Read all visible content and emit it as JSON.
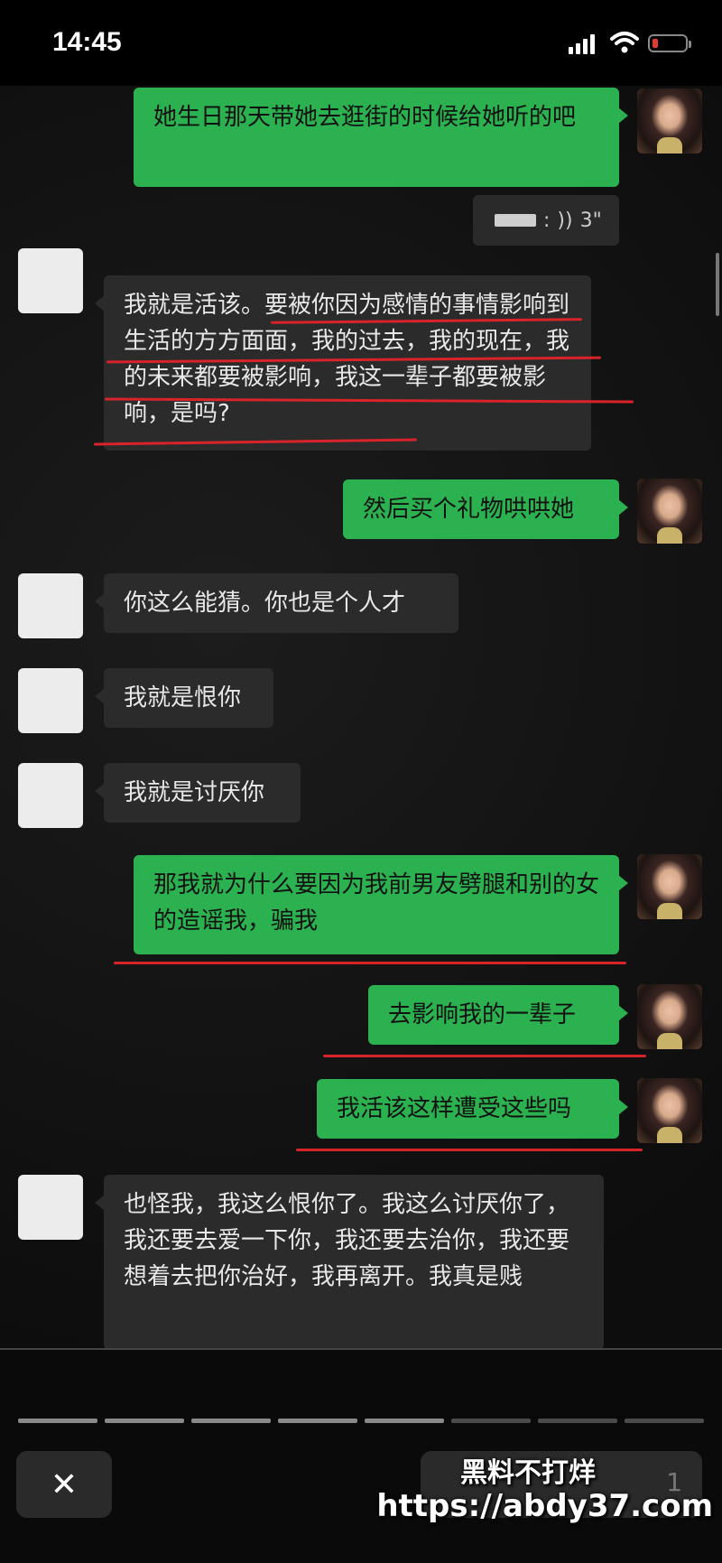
{
  "status": {
    "time": "14:45"
  },
  "voice": {
    "duration": "3\""
  },
  "messages": [
    {
      "side": "right",
      "text": "她生日那天带她去逛街的时候给她听的吧"
    },
    {
      "side": "left",
      "text": "我就是活该。要被你因为感情的事情影响到生活的方方面面，我的过去，我的现在，我的未来都要被影响，我这一辈子都要被影响，是吗?"
    },
    {
      "side": "right",
      "text": "然后买个礼物哄哄她"
    },
    {
      "side": "left",
      "text": "你这么能猜。你也是个人才"
    },
    {
      "side": "left",
      "text": "我就是恨你"
    },
    {
      "side": "left",
      "text": "我就是讨厌你"
    },
    {
      "side": "right",
      "text": "那我就为什么要因为我前男友劈腿和别的女的造谣我，骗我"
    },
    {
      "side": "right",
      "text": "去影响我的一辈子"
    },
    {
      "side": "right",
      "text": "我活该这样遭受这些吗"
    },
    {
      "side": "left",
      "text": "也怪我，我这么恨你了。我这么讨厌你了，我还要去爱一下你，我还要去治你，我还要想着去把你治好，我再离开。我真是贱"
    }
  ],
  "bottom": {
    "close_icon": "✕",
    "right_label": "1"
  },
  "watermark": {
    "line1": "黑料不打烊",
    "line2": "https://abdy37.com"
  }
}
